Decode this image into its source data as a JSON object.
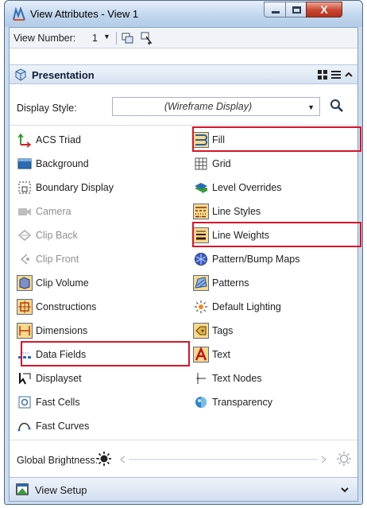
{
  "window": {
    "title": "View Attributes - View 1",
    "close_glyph": "X",
    "colors": {
      "frame": "#c9dcf0",
      "close": "#c9462f",
      "highlight": "#d8152a"
    }
  },
  "toolbar": {
    "view_number_label": "View Number:",
    "view_number_value": "1",
    "icons": [
      "copy-view-icon",
      "pick-view-icon"
    ]
  },
  "presentation": {
    "title": "Presentation",
    "icons": [
      "cube-icon",
      "grid-view-icon",
      "list-view-icon",
      "collapse-icon"
    ],
    "display_style_label": "Display Style:",
    "display_style_value": "(Wireframe Display)",
    "left_column": [
      {
        "label": "ACS Triad",
        "icon": "acs-triad-icon",
        "enabled": true
      },
      {
        "label": "Background",
        "icon": "background-icon",
        "enabled": true
      },
      {
        "label": "Boundary Display",
        "icon": "boundary-display-icon",
        "enabled": true
      },
      {
        "label": "Camera",
        "icon": "camera-icon",
        "enabled": false
      },
      {
        "label": "Clip Back",
        "icon": "clip-back-icon",
        "enabled": false
      },
      {
        "label": "Clip Front",
        "icon": "clip-front-icon",
        "enabled": false
      },
      {
        "label": "Clip Volume",
        "icon": "clip-volume-icon",
        "enabled": true,
        "active": true
      },
      {
        "label": "Constructions",
        "icon": "constructions-icon",
        "enabled": true,
        "active": true
      },
      {
        "label": "Dimensions",
        "icon": "dimensions-icon",
        "enabled": true,
        "active": true
      },
      {
        "label": "Data Fields",
        "icon": "data-fields-icon",
        "enabled": true,
        "highlighted": true
      },
      {
        "label": "Displayset",
        "icon": "displayset-icon",
        "enabled": true
      },
      {
        "label": "Fast Cells",
        "icon": "fast-cells-icon",
        "enabled": true
      },
      {
        "label": "Fast Curves",
        "icon": "fast-curves-icon",
        "enabled": true
      }
    ],
    "right_column": [
      {
        "label": "Fill",
        "icon": "fill-icon",
        "enabled": true,
        "active": true,
        "highlighted": true
      },
      {
        "label": "Grid",
        "icon": "grid-icon",
        "enabled": true
      },
      {
        "label": "Level Overrides",
        "icon": "level-overrides-icon",
        "enabled": true
      },
      {
        "label": "Line Styles",
        "icon": "line-styles-icon",
        "enabled": true,
        "active": true
      },
      {
        "label": "Line Weights",
        "icon": "line-weights-icon",
        "enabled": true,
        "active": true,
        "highlighted": true
      },
      {
        "label": "Pattern/Bump Maps",
        "icon": "pattern-bump-maps-icon",
        "enabled": true
      },
      {
        "label": "Patterns",
        "icon": "patterns-icon",
        "enabled": true,
        "active": true
      },
      {
        "label": "Default Lighting",
        "icon": "default-lighting-icon",
        "enabled": true
      },
      {
        "label": "Tags",
        "icon": "tags-icon",
        "enabled": true,
        "active": true
      },
      {
        "label": "Text",
        "icon": "text-icon",
        "enabled": true,
        "active": true
      },
      {
        "label": "Text Nodes",
        "icon": "text-nodes-icon",
        "enabled": true
      },
      {
        "label": "Transparency",
        "icon": "transparency-icon",
        "enabled": true
      }
    ],
    "global_brightness_label": "Global Brightness:"
  },
  "view_setup": {
    "title": "View Setup",
    "icon": "view-setup-icon"
  }
}
